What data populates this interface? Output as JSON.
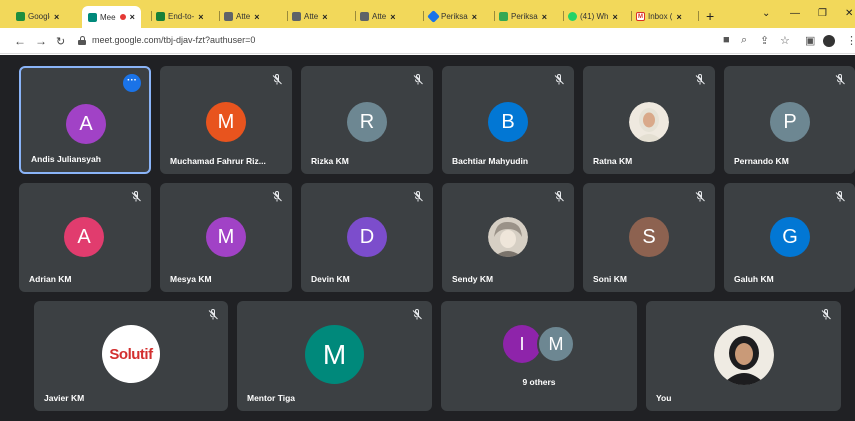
{
  "browser": {
    "tabs": [
      {
        "title": "Google",
        "icon": "google-classroom-icon",
        "color": "#1e8e3e"
      },
      {
        "title": "Mee",
        "icon": "google-meet-icon",
        "color": "#00897b",
        "active": true
      },
      {
        "title": "End-to-",
        "icon": "sheets-icon",
        "color": "#188038"
      },
      {
        "title": "Atte",
        "icon": "extension-icon",
        "color": "#5f6368"
      },
      {
        "title": "Atte",
        "icon": "extension-icon",
        "color": "#5f6368"
      },
      {
        "title": "Atte",
        "icon": "extension-icon",
        "color": "#5f6368"
      },
      {
        "title": "Periksa",
        "icon": "diamond-icon",
        "color": "#1a73e8"
      },
      {
        "title": "Periksa",
        "icon": "drive-icon",
        "color": "#34a853"
      },
      {
        "title": "(41) Wh",
        "icon": "whatsapp-icon",
        "color": "#25d366"
      },
      {
        "title": "Inbox (",
        "icon": "gmail-icon",
        "color": "#d93025"
      }
    ],
    "url": "meet.google.com/tbj-djav-fzt?authuser=0"
  },
  "participants": [
    {
      "name": "Andis Juliansyah",
      "initial": "A",
      "color": "#a142c6",
      "speaking": true,
      "muted": false
    },
    {
      "name": "Muchamad Fahrur Riz...",
      "initial": "M",
      "color": "#e8541e",
      "muted": true
    },
    {
      "name": "Rizka KM",
      "initial": "R",
      "color": "#6d8792",
      "muted": true
    },
    {
      "name": "Bachtiar Mahyudin",
      "initial": "B",
      "color": "#0277d4",
      "muted": true
    },
    {
      "name": "Ratna KM",
      "initial": "",
      "color": "#c9b89c",
      "photo": true,
      "muted": true
    },
    {
      "name": "Pernando KM",
      "initial": "P",
      "color": "#6d8792",
      "muted": true
    },
    {
      "name": "Adrian KM",
      "initial": "A",
      "color": "#e13c6e",
      "muted": true
    },
    {
      "name": "Mesya KM",
      "initial": "M",
      "color": "#a142c6",
      "muted": true
    },
    {
      "name": "Devin KM",
      "initial": "D",
      "color": "#7c4dcc",
      "muted": true
    },
    {
      "name": "Sendy KM",
      "initial": "",
      "color": "#d6cfc4",
      "photo": true,
      "muted": true
    },
    {
      "name": "Soni KM",
      "initial": "S",
      "color": "#8d6250",
      "muted": true
    },
    {
      "name": "Galuh KM",
      "initial": "G",
      "color": "#0277d4",
      "muted": true
    },
    {
      "name": "Javier KM",
      "initial": "",
      "logo": "Solutif",
      "muted": true
    },
    {
      "name": "Mentor Tiga",
      "initial": "M",
      "color": "#00897b",
      "muted": true
    },
    {
      "name": "9 others",
      "initials": [
        "I",
        "M"
      ],
      "colors": [
        "#8e24aa",
        "#6d8792"
      ],
      "muted": false
    },
    {
      "name": "You",
      "initial": "",
      "photo": true,
      "color": "#e9e4da",
      "muted": true
    }
  ]
}
